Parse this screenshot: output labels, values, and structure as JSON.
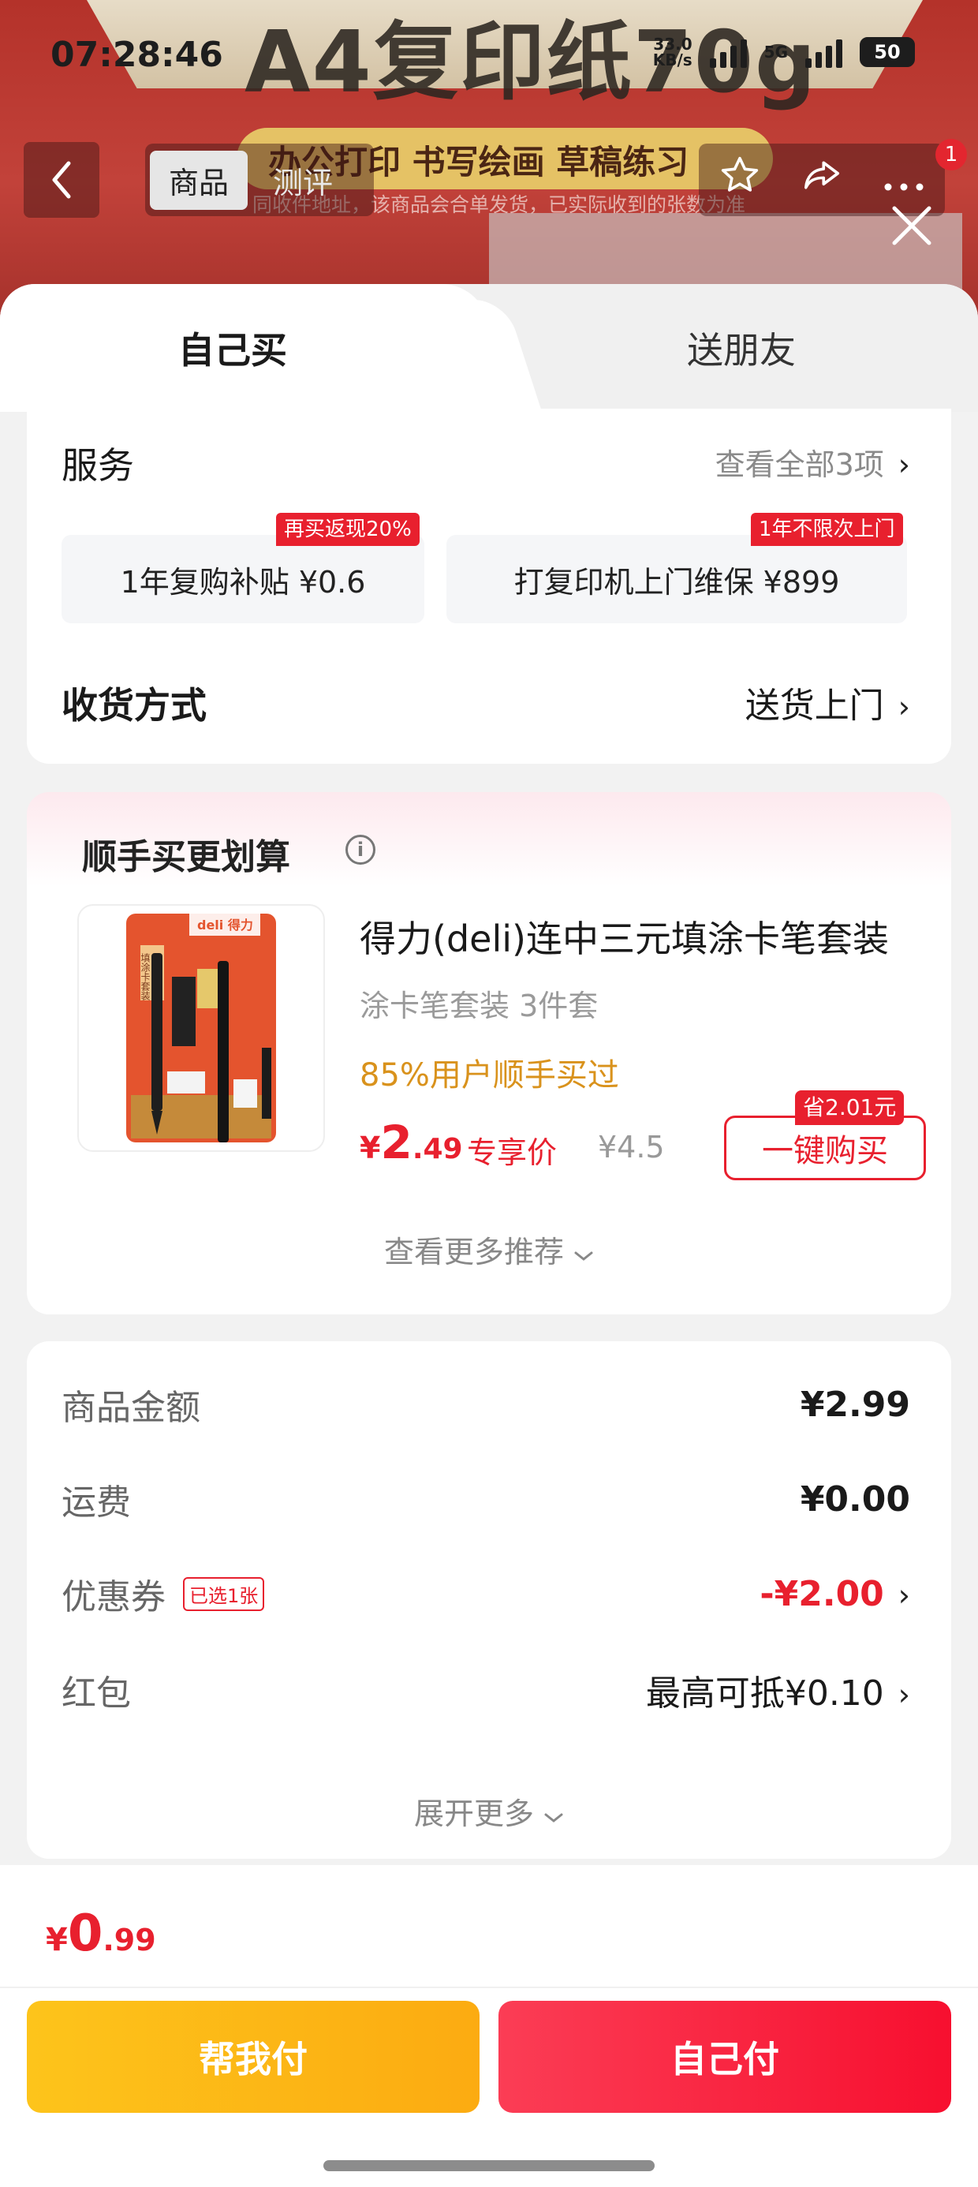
{
  "status_bar": {
    "time": "07:28:46",
    "speed_value": "33.0",
    "speed_unit": "KB/s",
    "network": "5G",
    "battery": "50"
  },
  "background_product": {
    "title": "A4复印纸70g",
    "subtitle": "办公打印 书写绘画 草稿练习",
    "notice": "同收件地址，该商品会合单发货，已实际收到的张数为准"
  },
  "nav": {
    "tab_active": "商品",
    "tab_other": "测评",
    "badge_count": "1"
  },
  "tabs": {
    "self": "自己买",
    "friend": "送朋友"
  },
  "service": {
    "title": "服务",
    "view_all": "查看全部3项",
    "options": [
      {
        "tag": "再买返现20%",
        "label": "1年复购补贴  ¥0.6"
      },
      {
        "tag": "1年不限次上门",
        "label": "打复印机上门维保  ¥899"
      }
    ],
    "delivery_label": "收货方式",
    "delivery_value": "送货上门"
  },
  "bundle": {
    "title": "顺手买更划算",
    "product": {
      "name": "得力(deli)连中三元填涂卡笔套装",
      "spec": "涂卡笔套装 3件套",
      "social": "85%用户顺手买过",
      "price_currency": "¥",
      "price_int": "2",
      "price_dec": ".49",
      "price_label": "专享价",
      "original_price": "¥4.5",
      "save_tag": "省2.01元",
      "buy_label": "一键购买",
      "image_brand": "deli 得力",
      "image_text": "填涂卡套装"
    },
    "more": "查看更多推荐"
  },
  "pricing": {
    "rows": [
      {
        "label": "商品金额",
        "value": "¥2.99"
      },
      {
        "label": "运费",
        "value": "¥0.00"
      },
      {
        "label": "优惠券",
        "chip": "已选1张",
        "value": "-¥2.00"
      },
      {
        "label": "红包",
        "value": "最高可抵¥0.10"
      }
    ],
    "expand": "展开更多"
  },
  "footer": {
    "total_currency": "¥",
    "total_int": "0",
    "total_dec": ".99",
    "help_pay": "帮我付",
    "self_pay": "自己付"
  },
  "colors": {
    "accent_red": "#e8202e",
    "gold": "#d9921c",
    "help_yellow": "#fdc41b"
  }
}
